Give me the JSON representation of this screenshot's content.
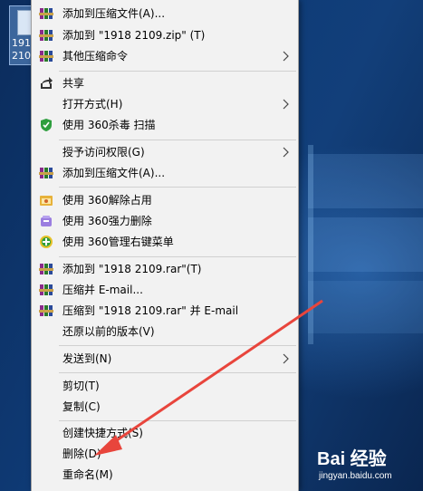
{
  "desktop": {
    "file_name": "1918\n2109"
  },
  "menu": {
    "items": [
      {
        "label": "添加到压缩文件(A)...",
        "icon": "winrar-icon"
      },
      {
        "label": "添加到 \"1918 2109.zip\" (T)",
        "icon": "winrar-icon"
      },
      {
        "label": "其他压缩命令",
        "icon": "winrar-icon",
        "submenu": true
      },
      {
        "label": "共享",
        "icon": "share-icon"
      },
      {
        "label": "打开方式(H)",
        "icon": "",
        "submenu": true
      },
      {
        "label": "使用 360杀毒 扫描",
        "icon": "360-antivirus-icon"
      },
      {
        "label": "授予访问权限(G)",
        "icon": "",
        "submenu": true
      },
      {
        "label": "添加到压缩文件(A)...",
        "icon": "winrar-icon"
      },
      {
        "label": "使用 360解除占用",
        "icon": "360-unlock-icon"
      },
      {
        "label": "使用 360强力删除",
        "icon": "360-force-delete-icon"
      },
      {
        "label": "使用 360管理右键菜单",
        "icon": "360-menu-manager-icon"
      },
      {
        "label": "添加到 \"1918 2109.rar\"(T)",
        "icon": "winrar-icon"
      },
      {
        "label": "压缩并 E-mail...",
        "icon": "winrar-icon"
      },
      {
        "label": "压缩到 \"1918 2109.rar\" 并 E-mail",
        "icon": "winrar-icon"
      },
      {
        "label": "还原以前的版本(V)",
        "icon": ""
      },
      {
        "label": "发送到(N)",
        "icon": "",
        "submenu": true
      },
      {
        "label": "剪切(T)",
        "icon": ""
      },
      {
        "label": "复制(C)",
        "icon": ""
      },
      {
        "label": "创建快捷方式(S)",
        "icon": ""
      },
      {
        "label": "删除(D)",
        "icon": ""
      },
      {
        "label": "重命名(M)",
        "icon": ""
      }
    ]
  },
  "colors": {
    "menu_bg": "#f2f2f2",
    "arrow": "#e8453c"
  },
  "watermark": {
    "brand": "Bai 经验",
    "url": "jingyan.baidu.com"
  }
}
